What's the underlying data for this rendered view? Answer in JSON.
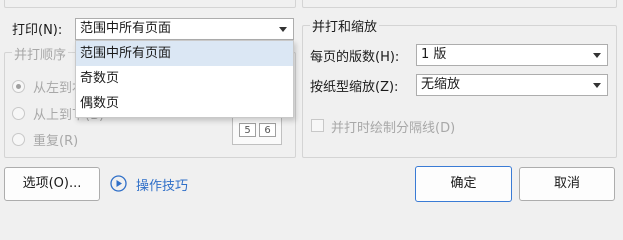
{
  "print_section": {
    "label": "打印(N):",
    "selected": "范围中所有页面",
    "options": [
      "范围中所有页面",
      "奇数页",
      "偶数页"
    ],
    "selected_index": 0
  },
  "collate_group": {
    "title": "并打顺序",
    "options": [
      {
        "label": "从左到右(F)",
        "checked": true
      },
      {
        "label": "从上到下(B)",
        "checked": false
      },
      {
        "label": "重复(R)",
        "checked": false
      }
    ],
    "preview_pages": [
      "5",
      "6"
    ]
  },
  "scale_group": {
    "title": "并打和缩放",
    "pages_per_sheet_label": "每页的版数(H):",
    "pages_per_sheet_value": "1 版",
    "scale_to_paper_label": "按纸型缩放(Z):",
    "scale_to_paper_value": "无缩放",
    "draw_borders_label": "并打时绘制分隔线(D)",
    "draw_borders_checked": false
  },
  "footer": {
    "options_button": "选项(O)...",
    "tips_link": "操作技巧",
    "ok_button": "确定",
    "cancel_button": "取消"
  },
  "colors": {
    "accent": "#3a7bd5",
    "link": "#2f6fc8",
    "selection": "#dbe7f4"
  }
}
